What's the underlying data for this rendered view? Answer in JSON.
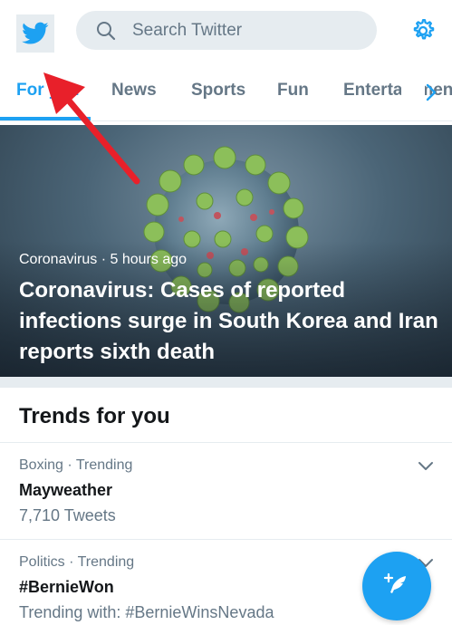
{
  "header": {
    "search_placeholder": "Search Twitter",
    "icons": {
      "logo": "twitter-bird-icon",
      "settings": "gear-icon"
    },
    "accent": "#1da1f2"
  },
  "tabs": {
    "items": [
      {
        "label": "For you",
        "active": true
      },
      {
        "label": "News",
        "active": false
      },
      {
        "label": "Sports",
        "active": false
      },
      {
        "label": "Fun",
        "active": false
      },
      {
        "label": "Entertainment",
        "active": false
      }
    ]
  },
  "hero": {
    "topic": "Coronavirus",
    "time": "5 hours ago",
    "headline": "Coronavirus: Cases of reported infections surge in South Korea and Iran reports sixth death"
  },
  "trends": {
    "title": "Trends for you",
    "items": [
      {
        "category": "Boxing · Trending",
        "name": "Mayweather",
        "detail": "7,710 Tweets"
      },
      {
        "category": "Politics · Trending",
        "name": "#BernieWon",
        "detail": "Trending with: #BernieWinsNevada"
      }
    ]
  },
  "fab": {
    "icon": "compose-tweet-icon"
  }
}
